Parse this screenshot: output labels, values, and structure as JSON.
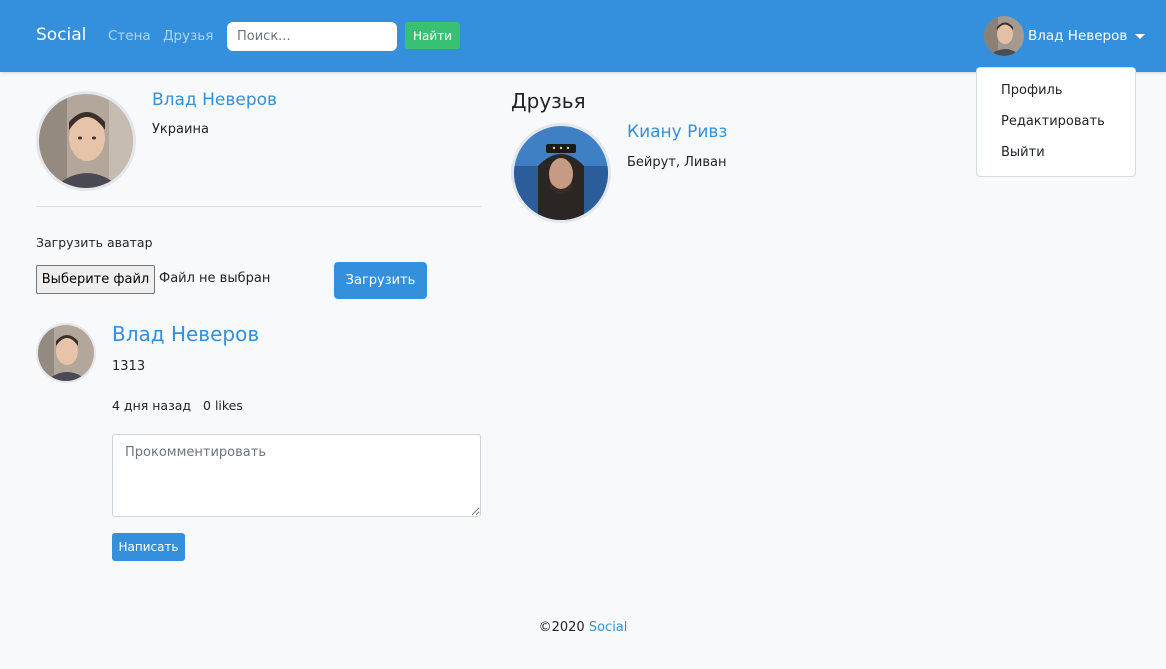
{
  "navbar": {
    "brand": "Social",
    "links": {
      "wall": "Стена",
      "friends": "Друзья"
    },
    "search": {
      "placeholder": "Поиск...",
      "button": "Найти"
    },
    "user": {
      "name": "Влад Неверов"
    }
  },
  "dropdown": {
    "items": [
      "Профиль",
      "Редактировать",
      "Выйти"
    ]
  },
  "profile": {
    "name": "Влад Неверов",
    "country": "Украина",
    "upload_label": "Загрузить аватар",
    "file_button": "Выберите файл",
    "file_status": "Файл не выбран",
    "upload_button": "Загрузить"
  },
  "post": {
    "author": "Влад Неверов",
    "text": "1313",
    "time": "4 дня назад",
    "likes": "0 likes",
    "comment_placeholder": "Прокомментировать",
    "submit": "Написать"
  },
  "friends": {
    "heading": "Друзья",
    "items": [
      {
        "name": "Киану Ривз",
        "location": "Бейрут, Ливан"
      }
    ]
  },
  "footer": {
    "copyright": "©2020",
    "link": "Social"
  },
  "colors": {
    "primary": "#3490dc",
    "success": "#38c172",
    "background": "#f8f9fb"
  },
  "icons": {
    "dropdown_caret": "caret-down-icon"
  }
}
